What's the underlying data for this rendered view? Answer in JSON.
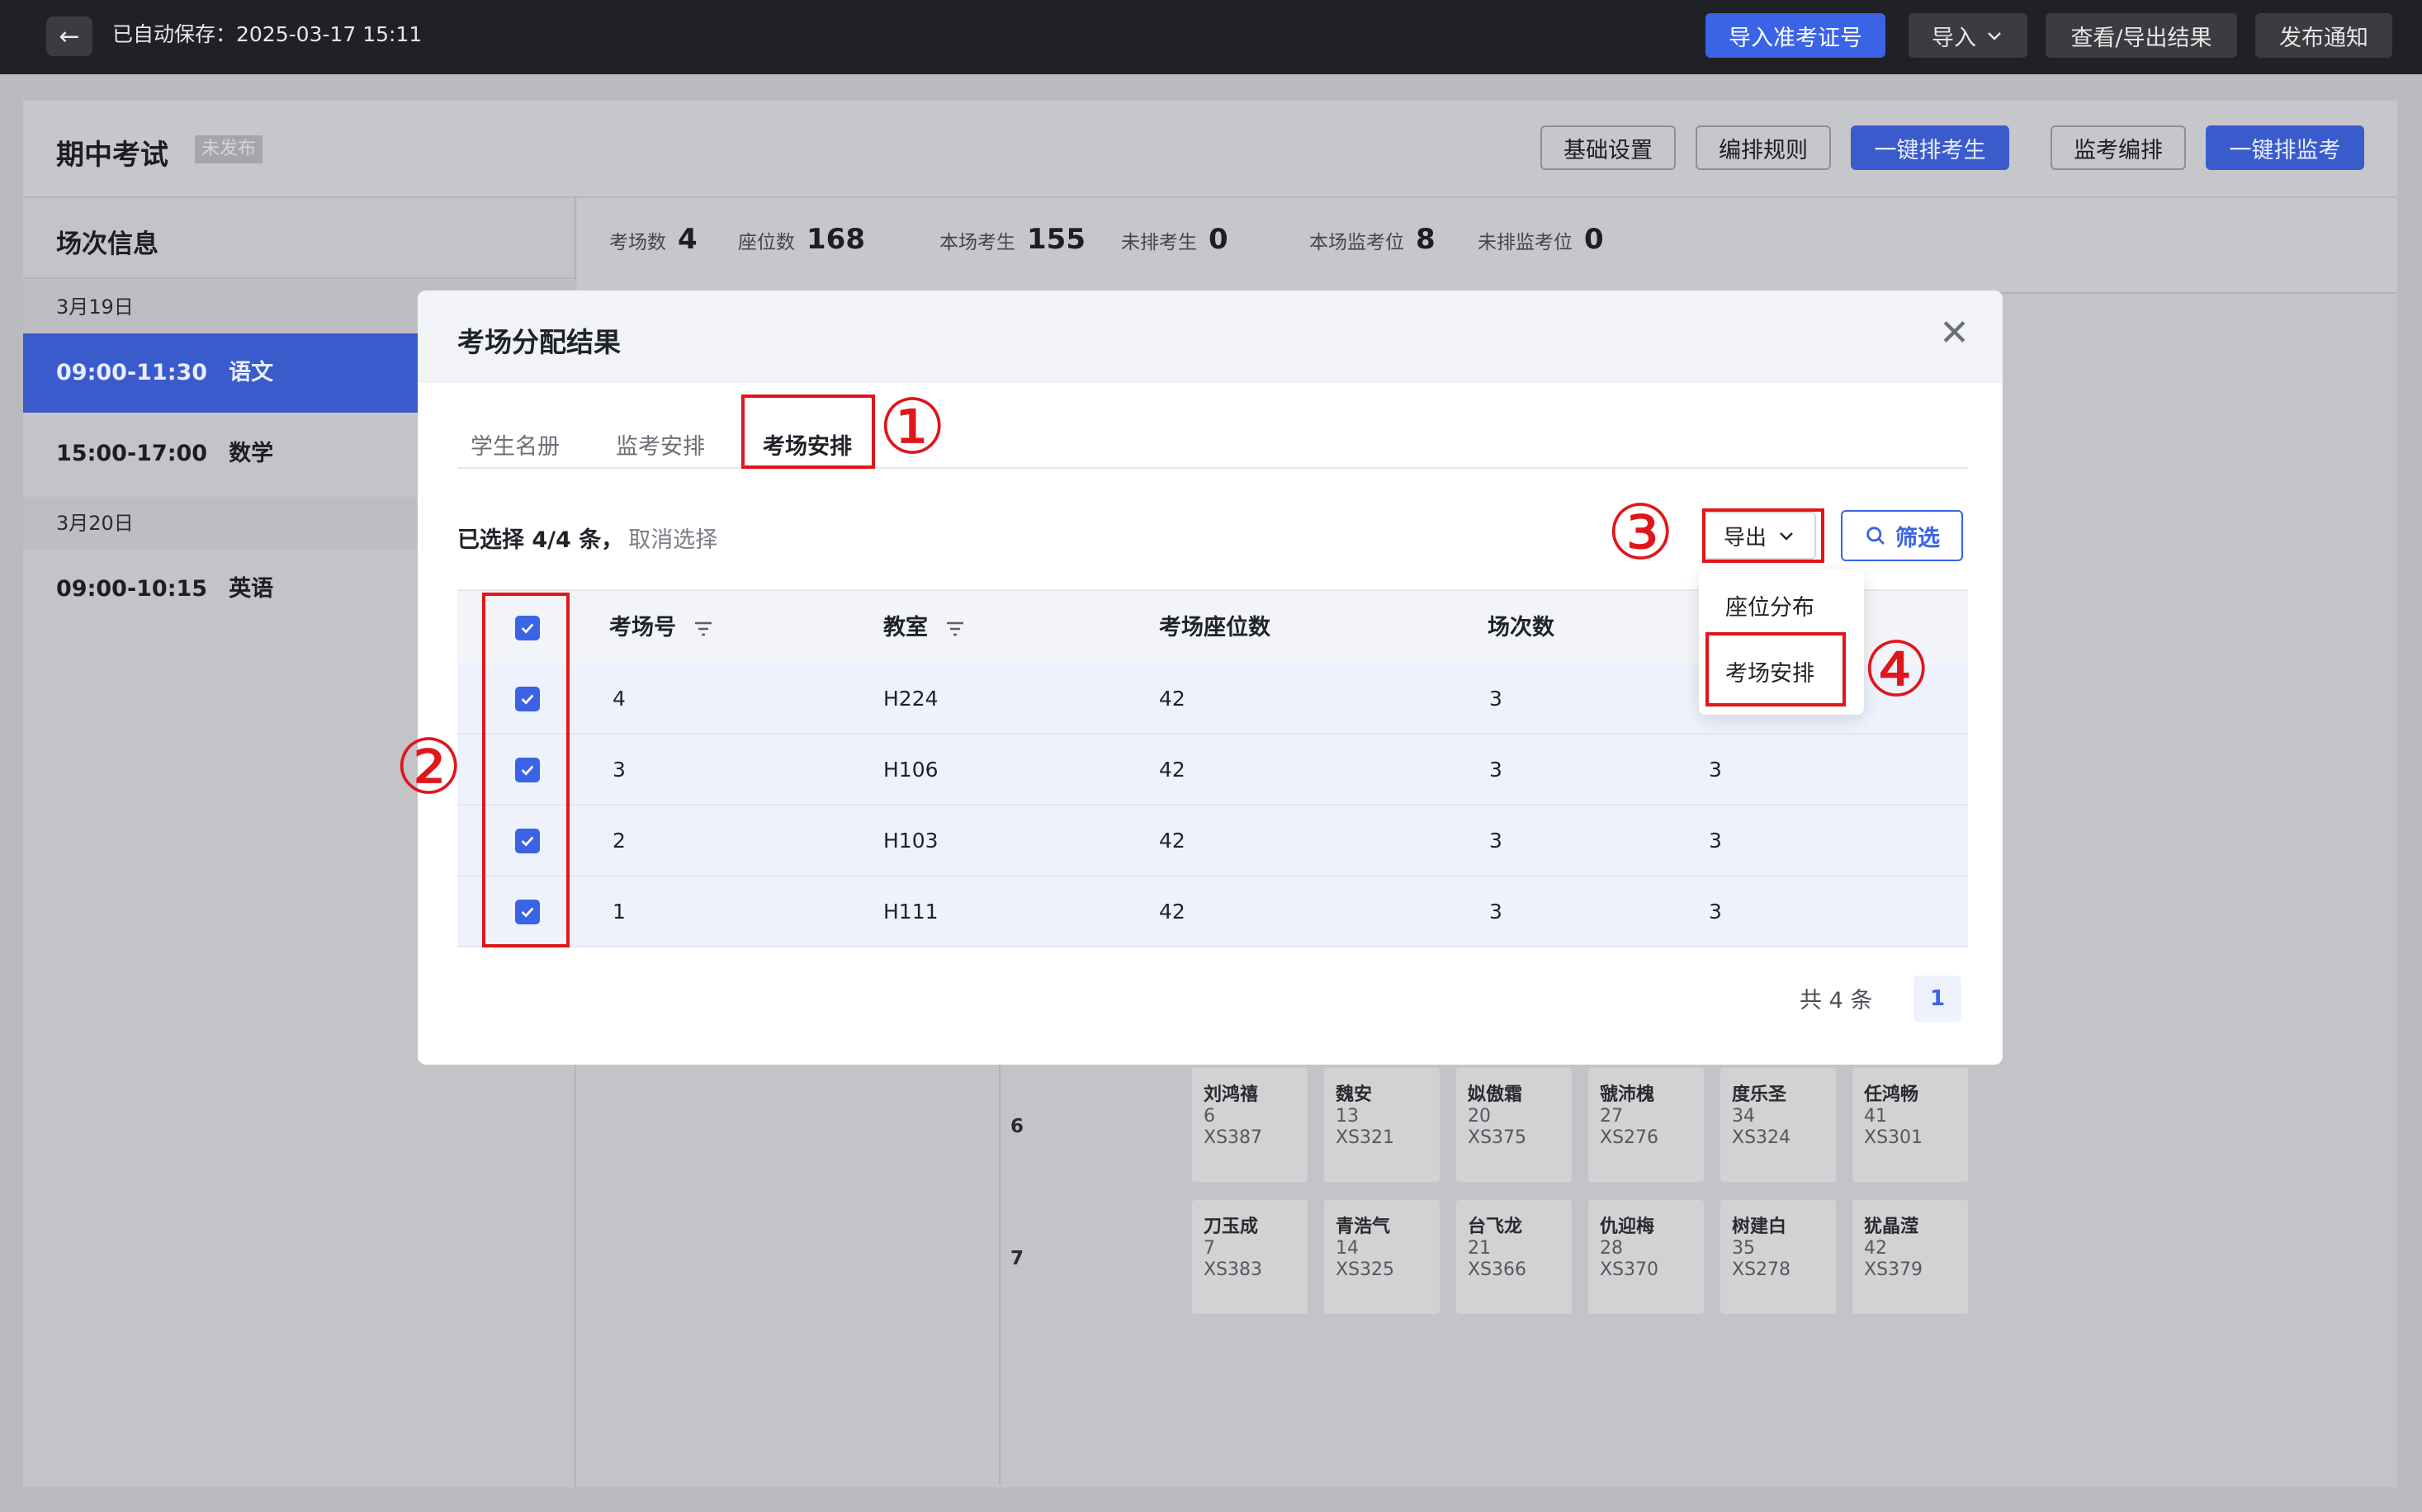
{
  "topbar": {
    "autosave": "已自动保存：2025-03-17 15:11",
    "buttons": {
      "import_ticket": "导入准考证号",
      "import": "导入",
      "view_export": "查看/导出结果",
      "publish": "发布通知"
    }
  },
  "header": {
    "title": "期中考试",
    "status": "未发布",
    "buttons": {
      "basic_settings": "基础设置",
      "rules": "编排规则",
      "auto_students": "一键排考生",
      "proctor_arrange": "监考编排",
      "auto_proctors": "一键排监考"
    }
  },
  "sidebar": {
    "title": "场次信息",
    "dates": [
      "3月19日",
      "3月20日"
    ],
    "sessions": [
      {
        "time": "09:00-11:30",
        "subject": "语文"
      },
      {
        "time": "15:00-17:00",
        "subject": "数学"
      },
      {
        "time": "09:00-10:15",
        "subject": "英语"
      }
    ]
  },
  "stats": [
    {
      "label": "考场数",
      "value": "4"
    },
    {
      "label": "座位数",
      "value": "168"
    },
    {
      "label": "本场考生",
      "value": "155"
    },
    {
      "label": "未排考生",
      "value": "0"
    },
    {
      "label": "本场监考位",
      "value": "8"
    },
    {
      "label": "未排监考位",
      "value": "0"
    }
  ],
  "seat_rows": [
    {
      "row": "6",
      "seats": [
        {
          "name": "刘鸿禧",
          "num": "6",
          "id": "XS387"
        },
        {
          "name": "魏安",
          "num": "13",
          "id": "XS321"
        },
        {
          "name": "姒傲霜",
          "num": "20",
          "id": "XS375"
        },
        {
          "name": "虢沛槐",
          "num": "27",
          "id": "XS276"
        },
        {
          "name": "度乐圣",
          "num": "34",
          "id": "XS324"
        },
        {
          "name": "任鸿畅",
          "num": "41",
          "id": "XS301"
        }
      ]
    },
    {
      "row": "7",
      "seats": [
        {
          "name": "刀玉成",
          "num": "7",
          "id": "XS383"
        },
        {
          "name": "青浩气",
          "num": "14",
          "id": "XS325"
        },
        {
          "name": "台飞龙",
          "num": "21",
          "id": "XS366"
        },
        {
          "name": "仇迎梅",
          "num": "28",
          "id": "XS370"
        },
        {
          "name": "树建白",
          "num": "35",
          "id": "XS278"
        },
        {
          "name": "犹晶滢",
          "num": "42",
          "id": "XS379"
        }
      ]
    }
  ],
  "modal": {
    "title": "考场分配结果",
    "tabs": [
      "学生名册",
      "监考安排",
      "考场安排"
    ],
    "active_tab": "考场安排",
    "selected_text": "已选择 4/4 条，",
    "cancel_select": "取消选择",
    "export_label": "导出",
    "filter_label": "筛选",
    "columns": [
      "考场号",
      "教室",
      "考场座位数",
      "场次数"
    ],
    "rows": [
      {
        "room": "4",
        "classroom": "H224",
        "seats": "42",
        "sessions": "3",
        "extra": ""
      },
      {
        "room": "3",
        "classroom": "H106",
        "seats": "42",
        "sessions": "3",
        "extra": "3"
      },
      {
        "room": "2",
        "classroom": "H103",
        "seats": "42",
        "sessions": "3",
        "extra": "3"
      },
      {
        "room": "1",
        "classroom": "H111",
        "seats": "42",
        "sessions": "3",
        "extra": "3"
      }
    ],
    "total": "共 4 条",
    "current_page": "1",
    "dropdown": [
      "座位分布",
      "考场安排"
    ]
  },
  "annotations": [
    "①",
    "②",
    "③",
    "④"
  ],
  "colors": {
    "primary": "#3a63e6",
    "annotation_red": "#e0161b",
    "topbar": "#1f2125"
  }
}
